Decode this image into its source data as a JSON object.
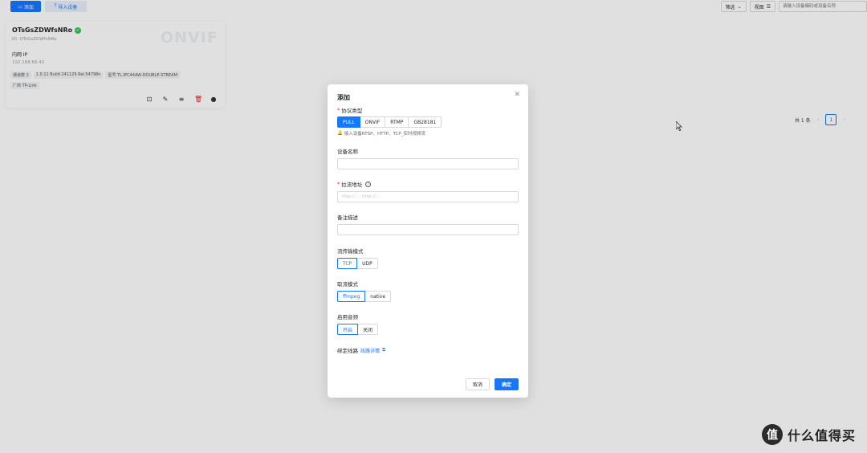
{
  "toolbar": {
    "add_label": "添加",
    "import_label": "导入设备",
    "filter_label": "筛选",
    "view_label": "视图",
    "search_placeholder": "请输入设备编码或设备名称"
  },
  "device": {
    "name": "OTsGsZDWfsNRo",
    "id_text": "ID: OTsGsZDWfsNRo",
    "watermark": "ONVIF",
    "ip_label": "内网 IP",
    "ip": "192.168.66.42",
    "chips": [
      "通道数 2",
      "1.0.11 Build 241129 Rel.54798n",
      "型号 TL-IPC44AW-DOUBLE-STREAM"
    ],
    "vendor": "厂商 TP-Link"
  },
  "pager": {
    "total": "共 1 条",
    "current": "1"
  },
  "modal": {
    "title": "添加",
    "protocol_label": "协议类型",
    "protocols": [
      "PULL",
      "ONVIF",
      "RTMP",
      "GB28181"
    ],
    "protocol_selected": "PULL",
    "protocol_hint": "接入设备RTSP、HTTP、TCP_实时视频流",
    "name_label": "设备名称",
    "name_value": "",
    "url_label": "拉流地址",
    "url_placeholder": "rtsp://..., http://...",
    "desc_label": "备注描述",
    "desc_value": "",
    "transport_label": "流传输模式",
    "transports": [
      "TCP",
      "UDP"
    ],
    "transport_selected": "TCP",
    "pull_mode_label": "取流模式",
    "pull_modes": [
      "ffmpeg",
      "native"
    ],
    "pull_mode_selected": "ffmpeg",
    "audio_label": "启用音频",
    "audio_options": [
      "开启",
      "关闭"
    ],
    "audio_selected": "开启",
    "route_label": "绑定线路",
    "route_link": "线路详情",
    "cancel_label": "取消",
    "ok_label": "确定"
  },
  "brand": {
    "logo_char": "值",
    "text": "什么值得买"
  },
  "colors": {
    "primary": "#1677ff",
    "danger": "#f5222d",
    "online": "#34c759"
  }
}
